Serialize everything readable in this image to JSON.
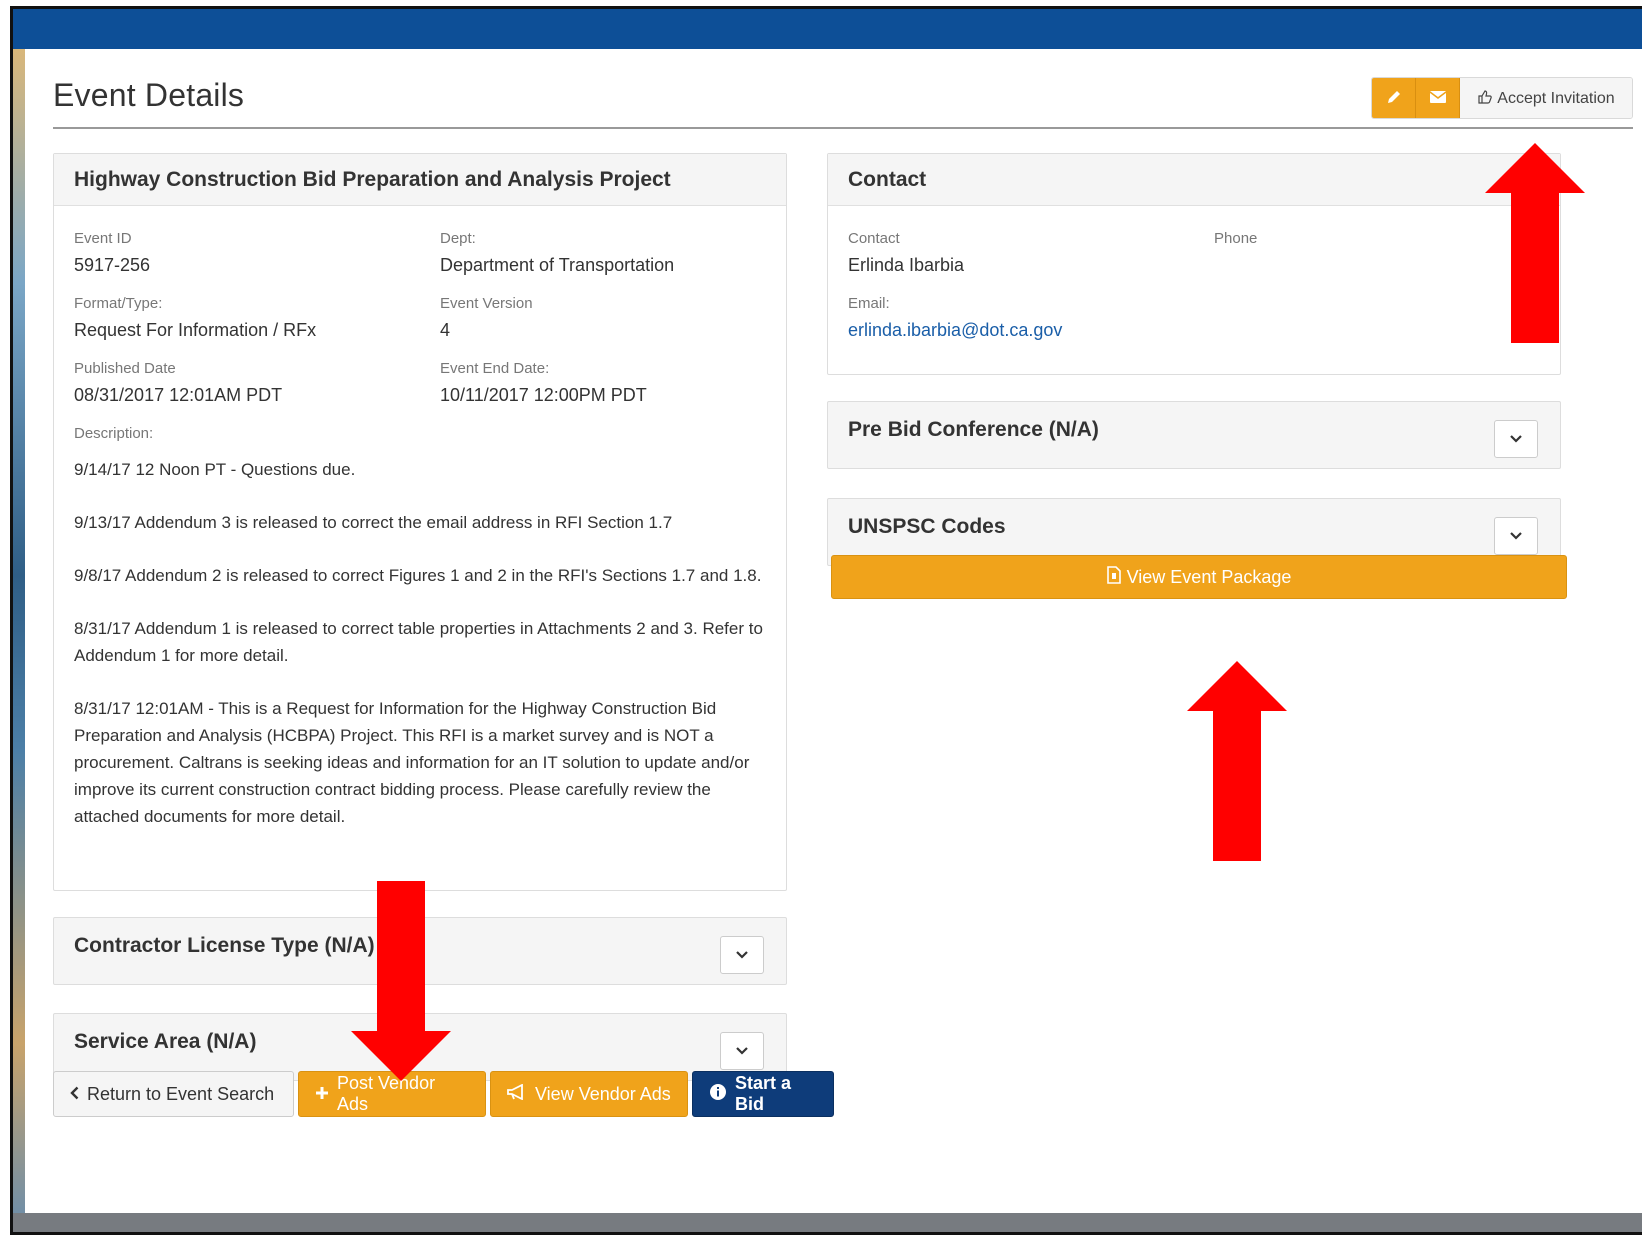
{
  "page": {
    "title": "Event Details"
  },
  "top_actions": {
    "accept_label": "Accept Invitation"
  },
  "event_panel": {
    "heading": "Highway Construction Bid Preparation and Analysis Project",
    "event_id_label": "Event ID",
    "event_id": "5917-256",
    "dept_label": "Dept:",
    "dept": "Department of Transportation",
    "format_label": "Format/Type:",
    "format": "Request For Information / RFx",
    "version_label": "Event Version",
    "version": "4",
    "published_label": "Published Date",
    "published": "08/31/2017 12:01AM PDT",
    "end_label": "Event End Date:",
    "end": "10/11/2017 12:00PM PDT",
    "description_label": "Description:",
    "description": [
      "9/14/17 12 Noon PT - Questions due.",
      "9/13/17 Addendum 3 is released to correct the email address in RFI Section 1.7",
      "9/8/17 Addendum 2 is released to correct Figures 1 and 2 in the RFI's Sections 1.7 and 1.8.",
      "8/31/17 Addendum 1 is released to correct table properties in Attachments 2 and 3. Refer to Addendum 1 for more detail.",
      "8/31/17 12:01AM - This is a Request for Information for the Highway Construction Bid Preparation and Analysis (HCBPA) Project. This RFI is a market survey and is NOT a procurement.  Caltrans is seeking ideas and information for an IT solution to update and/or improve its current construction contract bidding process.  Please carefully review the attached documents for more detail."
    ]
  },
  "contact_panel": {
    "heading": "Contact",
    "contact_label": "Contact",
    "contact": "Erlinda Ibarbia",
    "phone_label": "Phone",
    "email_label": "Email:",
    "email": "erlinda.ibarbia@dot.ca.gov"
  },
  "collapsibles": {
    "pre_bid": "Pre Bid Conference (N/A)",
    "unspsc": "UNSPSC Codes",
    "contractor": "Contractor License Type (N/A)",
    "service_area": "Service Area (N/A)"
  },
  "view_package_label": "View Event Package",
  "bottom_buttons": {
    "return": "Return to Event Search",
    "post_ads": "Post Vendor Ads",
    "view_ads": "View Vendor Ads",
    "start_bid": "Start a Bid"
  },
  "colors": {
    "header_blue": "#0d4f97",
    "accent_orange": "#f0a31b",
    "navy": "#0e3c7a",
    "arrow_red": "#ff0000"
  }
}
